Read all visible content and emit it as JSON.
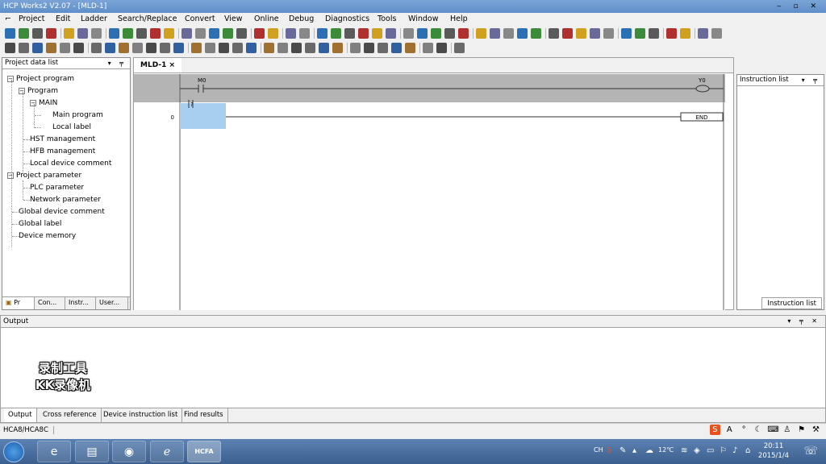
{
  "window": {
    "title": "HCP Works2 V2.07 - [MLD-1]",
    "controls": "‒ ▫ ✕"
  },
  "menu": {
    "items": [
      "Project",
      "Edit",
      "Ladder",
      "Search/Replace",
      "Convert",
      "View",
      "Online",
      "Debug",
      "Diagnostics",
      "Tools",
      "Window",
      "Help"
    ]
  },
  "left_panel": {
    "title": "Project data list",
    "controls": "▾ ╤",
    "tree": {
      "project_program": "Project program",
      "program": "Program",
      "main": "MAIN",
      "main_program": "Main program",
      "local_label": "Local label",
      "hst_management": "HST management",
      "hfb_management": "HFB management",
      "local_device_comment": "Local device comment",
      "project_parameter": "Project parameter",
      "plc_parameter": "PLC parameter",
      "network_parameter": "Network parameter",
      "global_device_comment": "Global device comment",
      "global_label": "Global label",
      "device_memory": "Device memory"
    },
    "tabs": [
      "Pr",
      "Con...",
      "Instr...",
      "User..."
    ]
  },
  "editor": {
    "tab_label": "MLD-1 ×",
    "rung_contact": "M0",
    "rung_coil": "Y0",
    "cursor_contact": "?",
    "step_number": "0",
    "end_instruction": "END"
  },
  "right_panel": {
    "title": "Instruction list",
    "controls": "▾ ╤",
    "tab": "Instruction list"
  },
  "output_panel": {
    "title": "Output",
    "controls": "▾ ╤ ✕",
    "tabs": [
      "Output",
      "Cross reference",
      "Device instruction list",
      "Find results"
    ]
  },
  "watermark": {
    "line1": "录制工具",
    "line2": "KK录像机"
  },
  "status": {
    "plc_model": "HCA8/HCA8C"
  },
  "taskbar": {
    "app_label": "HCFA",
    "tray_lang": "CH",
    "temperature": "12℃",
    "time": "20:11",
    "date": "2015/1/4"
  }
}
